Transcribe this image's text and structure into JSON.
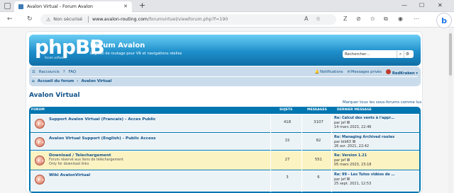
{
  "browser": {
    "tab_title": "Avalon Virtual - Forum Avalon",
    "new_tab": "+",
    "close_tab": "✕",
    "back": "←",
    "refresh": "↻",
    "security_label": "Non sécurisé",
    "url_host": "www.avalon-routing.com",
    "url_path": "/forumvirtuel/viewforum.php?f=190",
    "win_min": "—",
    "win_max": "☐",
    "win_close": "✕"
  },
  "site": {
    "logo_text": "phpBB",
    "logo_sub": "forum software",
    "title": "Forum Avalon",
    "description": "Logiciel de routage pour VR et navigations réelles",
    "search_placeholder": "Rechercher…"
  },
  "navbar": {
    "shortcuts": "Raccourcis",
    "faq": "FAQ",
    "notifications": "Notifications",
    "private_messages": "Messages privés",
    "username": "RedKraken"
  },
  "breadcrumb": {
    "home": "Accueil du forum",
    "current": "Avalon Virtual"
  },
  "page": {
    "title": "Avalon Virtual",
    "mark_all": "Marquer tous les sous-forums comme lus"
  },
  "table": {
    "headers": {
      "forum": "FORUM",
      "topics": "SUJETS",
      "messages": "MESSAGES",
      "last_message": "DERNIER MESSAGE"
    },
    "rows": [
      {
        "name": "Support Avalon Virtual (Francais) - Acces Public",
        "desc1": "",
        "desc2": "",
        "topics": "418",
        "messages": "3107",
        "last_title": "Re: Calcul des vents à l'appr…",
        "last_by": "par jef",
        "last_date": "14 mars 2023, 22:46"
      },
      {
        "name": "Avalon Virtual Support (English) - Public Access",
        "desc1": "",
        "desc2": "",
        "topics": "15",
        "messages": "82",
        "last_title": "Re: Managing Archived routes",
        "last_by": "par bib63",
        "last_date": "26 avr. 2021, 22:42"
      },
      {
        "name": "Download / Telechargement",
        "desc1": "Forum réservé aux liens de téléchargement",
        "desc2": "Only for download links",
        "topics": "27",
        "messages": "551",
        "last_title": "Re: Version 1.21",
        "last_by": "par jef",
        "last_date": "05 mars 2023, 23:18"
      },
      {
        "name": "Wiki AvalonVirtual",
        "desc1": "",
        "desc2": "",
        "topics": "3",
        "messages": "6",
        "last_title": "Re: 99 - Les Tutos vidéos de …",
        "last_by": "par jef",
        "last_date": "25 sept. 2021, 12:53"
      }
    ]
  },
  "icons": {
    "shortcuts": "menu-icon",
    "faq": "question-icon",
    "notifications": "bell-icon",
    "messages": "envelope-icon",
    "search": "search-icon",
    "advanced_search": "gear-icon",
    "forum_unread": "forum-read-icon"
  },
  "colors": {
    "header_blue": "#1e8fcb",
    "link_blue": "#105289",
    "forum_table": "#0076b1",
    "row_bg": "#ecf3f7",
    "highlight_row": "#fcf3c3",
    "navbar_bg": "#cadceb"
  }
}
